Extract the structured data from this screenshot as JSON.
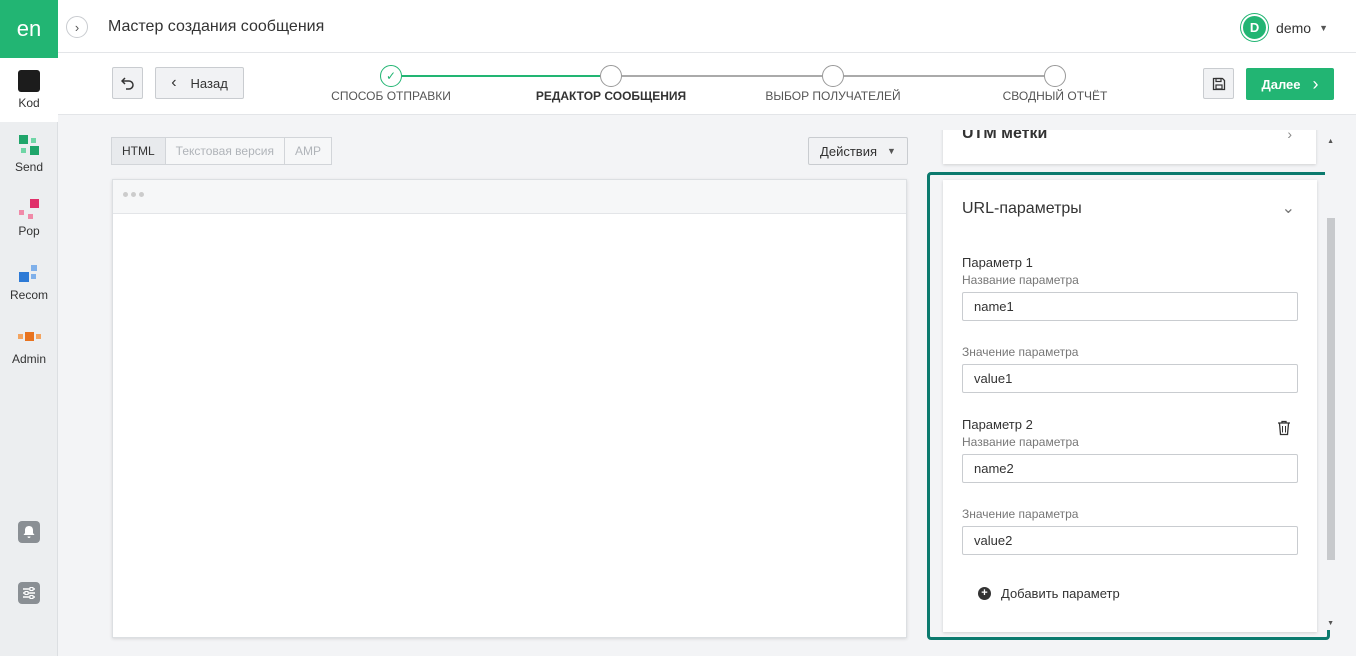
{
  "logo": "en",
  "rail": {
    "items": [
      {
        "label": "Kod"
      },
      {
        "label": "Send"
      },
      {
        "label": "Pop"
      },
      {
        "label": "Recom"
      },
      {
        "label": "Admin"
      }
    ]
  },
  "header": {
    "title": "Мастер создания сообщения",
    "user_initial": "D",
    "user_name": "demo"
  },
  "wizard": {
    "back_label": "Назад",
    "next_label": "Далее",
    "steps": [
      {
        "label": "СПОСОБ ОТПРАВКИ",
        "state": "done"
      },
      {
        "label": "РЕДАКТОР СООБЩЕНИЯ",
        "state": "active"
      },
      {
        "label": "ВЫБОР ПОЛУЧАТЕЛЕЙ",
        "state": "pending"
      },
      {
        "label": "СВОДНЫЙ ОТЧЁТ",
        "state": "pending"
      }
    ]
  },
  "editor": {
    "tabs": [
      {
        "label": "HTML",
        "active": true
      },
      {
        "label": "Текстовая версия",
        "active": false
      },
      {
        "label": "AMP",
        "active": false
      }
    ],
    "actions_label": "Действия"
  },
  "panel": {
    "utm_title": "UTM метки",
    "url_title": "URL-параметры",
    "params": [
      {
        "title": "Параметр 1",
        "name_label": "Название параметра",
        "name_value": "name1",
        "value_label": "Значение параметра",
        "value_value": "value1"
      },
      {
        "title": "Параметр 2",
        "name_label": "Название параметра",
        "name_value": "name2",
        "value_label": "Значение параметра",
        "value_value": "value2"
      }
    ],
    "add_label": "Добавить параметр"
  },
  "colors": {
    "accent": "#22b573",
    "highlight": "#0b7a6e"
  }
}
